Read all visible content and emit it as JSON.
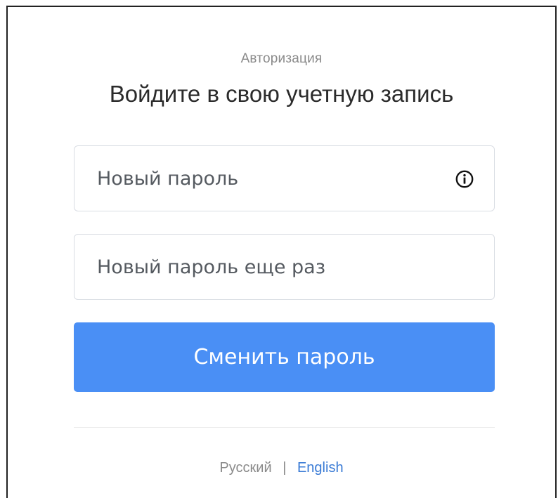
{
  "auth": {
    "subtitle": "Авторизация",
    "title": "Войдите в свою учетную запись"
  },
  "form": {
    "new_password": {
      "placeholder": "Новый пароль",
      "value": "",
      "icon": "info-icon"
    },
    "repeat_password": {
      "placeholder": "Новый пароль еще раз",
      "value": ""
    },
    "submit_label": "Сменить пароль"
  },
  "languages": {
    "russian": "Русский",
    "separator": "|",
    "english": "English",
    "active": "English"
  },
  "colors": {
    "primary_button": "#4a8ff5",
    "link": "#3a7bd5",
    "muted_text": "#8a8a8a",
    "border": "#d9dde3"
  }
}
